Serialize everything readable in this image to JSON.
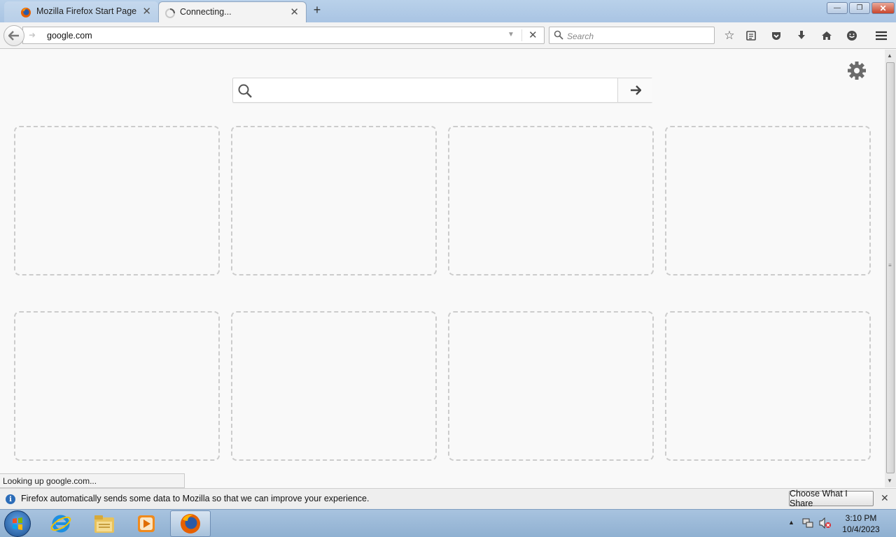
{
  "tabs": [
    {
      "label": "Mozilla Firefox Start Page",
      "icon": "firefox-icon"
    },
    {
      "label": "Connecting...",
      "icon": "loading-spinner-icon"
    }
  ],
  "new_tab_label": "+",
  "window_controls": {
    "minimize": "—",
    "maximize": "❐",
    "close": "✕"
  },
  "navbar": {
    "url_value": "google.com",
    "search_placeholder": "Search"
  },
  "new_tab_page": {
    "search_placeholder": ""
  },
  "tile_count": 8,
  "status_text": "Looking up google.com...",
  "notification": {
    "text": "Firefox automatically sends some data to Mozilla so that we can improve your experience.",
    "button_label": "Choose What I Share",
    "info_glyph": "i"
  },
  "taskbar": {
    "apps": [
      "start-orb",
      "internet-explorer-icon",
      "file-explorer-icon",
      "media-player-icon",
      "firefox-icon"
    ],
    "time": "3:10 PM",
    "date": "10/4/2023"
  },
  "colors": {
    "accent": "#2b6cb8",
    "tab_strip": "#b9d1ea",
    "taskbar": "#9cb9d8"
  }
}
